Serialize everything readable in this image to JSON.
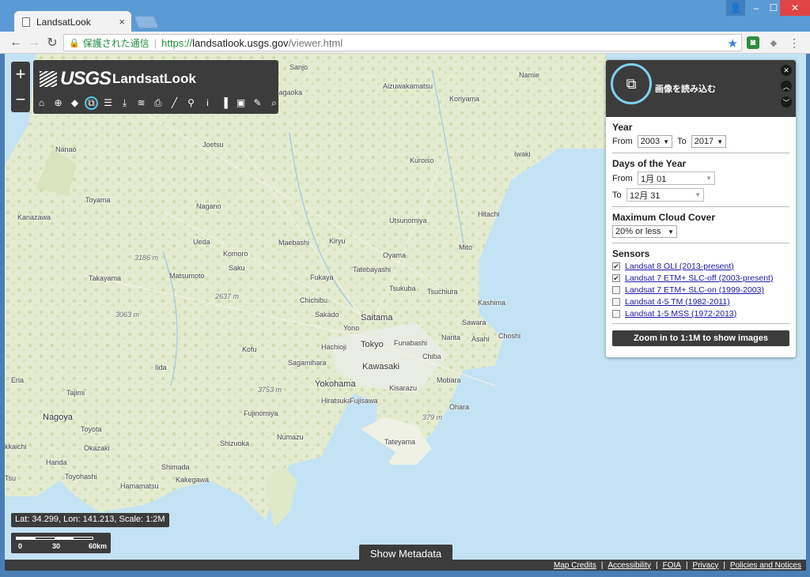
{
  "browser": {
    "tab_title": "LandsatLook",
    "tab_close": "×",
    "secure_label": "保護された通信",
    "url_scheme": "https://",
    "url_host": "landsatlook.usgs.gov",
    "url_path": "/viewer.html",
    "icons": [
      "back-arrow-icon",
      "forward-arrow-icon",
      "reload-icon",
      "lock-icon",
      "star-icon",
      "menu-icon"
    ]
  },
  "app": {
    "zoom_in": "+",
    "zoom_out": "−",
    "logo_text": "USGS",
    "name": "LandsatLook",
    "tool_icons": [
      "home-icon",
      "locate-icon",
      "tag-icon",
      "load-images-icon",
      "filter-icon",
      "download-icon",
      "layers-icon",
      "print-icon",
      "measure-icon",
      "identify-icon",
      "info-icon",
      "compare-icon",
      "bookmark-icon",
      "edit-icon",
      "search-icon"
    ]
  },
  "map": {
    "places": [
      {
        "name": "Sanjo",
        "cls": ""
      },
      {
        "name": "Aizuwakamatsu",
        "cls": ""
      },
      {
        "name": "Namie",
        "cls": ""
      },
      {
        "name": "Nagaoka",
        "cls": ""
      },
      {
        "name": "Koriyama",
        "cls": ""
      },
      {
        "name": "Joetsu",
        "cls": ""
      },
      {
        "name": "Nanao",
        "cls": ""
      },
      {
        "name": "Iwaki",
        "cls": ""
      },
      {
        "name": "Kuroiso",
        "cls": ""
      },
      {
        "name": "Toyama",
        "cls": ""
      },
      {
        "name": "Nagano",
        "cls": ""
      },
      {
        "name": "Kanazawa",
        "cls": ""
      },
      {
        "name": "Utsunomiya",
        "cls": ""
      },
      {
        "name": "Hitachi",
        "cls": ""
      },
      {
        "name": "Ueda",
        "cls": ""
      },
      {
        "name": "Maebashi",
        "cls": ""
      },
      {
        "name": "Kiryu",
        "cls": ""
      },
      {
        "name": "Mito",
        "cls": ""
      },
      {
        "name": "Komoro",
        "cls": ""
      },
      {
        "name": "Oyama",
        "cls": ""
      },
      {
        "name": "3186 m",
        "cls": "elev"
      },
      {
        "name": "Saku",
        "cls": ""
      },
      {
        "name": "Tatebayashi",
        "cls": ""
      },
      {
        "name": "Takayama",
        "cls": ""
      },
      {
        "name": "Matsumoto",
        "cls": ""
      },
      {
        "name": "Fukaya",
        "cls": ""
      },
      {
        "name": "Tsukuba",
        "cls": ""
      },
      {
        "name": "Tsuchiura",
        "cls": ""
      },
      {
        "name": "2637 m",
        "cls": "elev"
      },
      {
        "name": "Chichibu",
        "cls": ""
      },
      {
        "name": "Kashima",
        "cls": ""
      },
      {
        "name": "3063 m",
        "cls": "elev"
      },
      {
        "name": "Sakado",
        "cls": ""
      },
      {
        "name": "Saitama",
        "cls": "big"
      },
      {
        "name": "Yono",
        "cls": ""
      },
      {
        "name": "Sawara",
        "cls": ""
      },
      {
        "name": "Narita",
        "cls": ""
      },
      {
        "name": "Asahi",
        "cls": ""
      },
      {
        "name": "Choshi",
        "cls": ""
      },
      {
        "name": "Kofu",
        "cls": ""
      },
      {
        "name": "Hachioji",
        "cls": ""
      },
      {
        "name": "Tokyo",
        "cls": "big"
      },
      {
        "name": "Funabashi",
        "cls": ""
      },
      {
        "name": "Chiba",
        "cls": ""
      },
      {
        "name": "Iida",
        "cls": ""
      },
      {
        "name": "Sagamihara",
        "cls": ""
      },
      {
        "name": "Kawasaki",
        "cls": "big"
      },
      {
        "name": "Mobara",
        "cls": ""
      },
      {
        "name": "Ena",
        "cls": ""
      },
      {
        "name": "Yokohama",
        "cls": "big"
      },
      {
        "name": "Kisarazu",
        "cls": ""
      },
      {
        "name": "Tajimi",
        "cls": ""
      },
      {
        "name": "3753 m",
        "cls": "elev"
      },
      {
        "name": "Hiratsuka",
        "cls": ""
      },
      {
        "name": "Fujisawa",
        "cls": ""
      },
      {
        "name": "Ohara",
        "cls": ""
      },
      {
        "name": "Nagoya",
        "cls": "big"
      },
      {
        "name": "Fujinomiya",
        "cls": ""
      },
      {
        "name": "379 m",
        "cls": "elev"
      },
      {
        "name": "Toyota",
        "cls": ""
      },
      {
        "name": "Numazu",
        "cls": ""
      },
      {
        "name": "Shizuoka",
        "cls": ""
      },
      {
        "name": "Tateyama",
        "cls": ""
      },
      {
        "name": "kkaichi",
        "cls": ""
      },
      {
        "name": "Okazaki",
        "cls": ""
      },
      {
        "name": "Handa",
        "cls": ""
      },
      {
        "name": "Shimada",
        "cls": ""
      },
      {
        "name": "Toyohashi",
        "cls": ""
      },
      {
        "name": "Kakegawa",
        "cls": ""
      },
      {
        "name": "Tsu",
        "cls": ""
      },
      {
        "name": "Hamamatsu",
        "cls": ""
      }
    ]
  },
  "status": {
    "coords": "Lat: 34.299, Lon: 141.213, Scale: 1:2M",
    "scale_0": "0",
    "scale_30": "30",
    "scale_60": "60km",
    "metadata_button": "Show Metadata"
  },
  "footer": {
    "links": [
      "Map Credits",
      "Accessibility",
      "FOIA",
      "Privacy",
      "Policies and Notices"
    ]
  },
  "panel": {
    "title": "画像を読み込む",
    "year_heading": "Year",
    "from_label": "From",
    "year_from": "2003",
    "to_label": "To",
    "year_to": "2017",
    "days_heading": "Days of the Year",
    "day_from": "1月 01",
    "day_to": "12月 31",
    "cloud_heading": "Maximum Cloud Cover",
    "cloud_value": "20% or less",
    "sensors_heading": "Sensors",
    "sensors": [
      {
        "label": "Landsat 8 OLI (2013-present)",
        "checked": true
      },
      {
        "label": "Landsat 7 ETM+ SLC-off (2003-present)",
        "checked": true
      },
      {
        "label": "Landsat 7 ETM+ SLC-on (1999-2003)",
        "checked": false
      },
      {
        "label": "Landsat 4-5 TM (1982-2011)",
        "checked": false
      },
      {
        "label": "Landsat 1-5 MSS (1972-2013)",
        "checked": false
      }
    ],
    "zoom_button": "Zoom in to 1:1M to show images"
  }
}
